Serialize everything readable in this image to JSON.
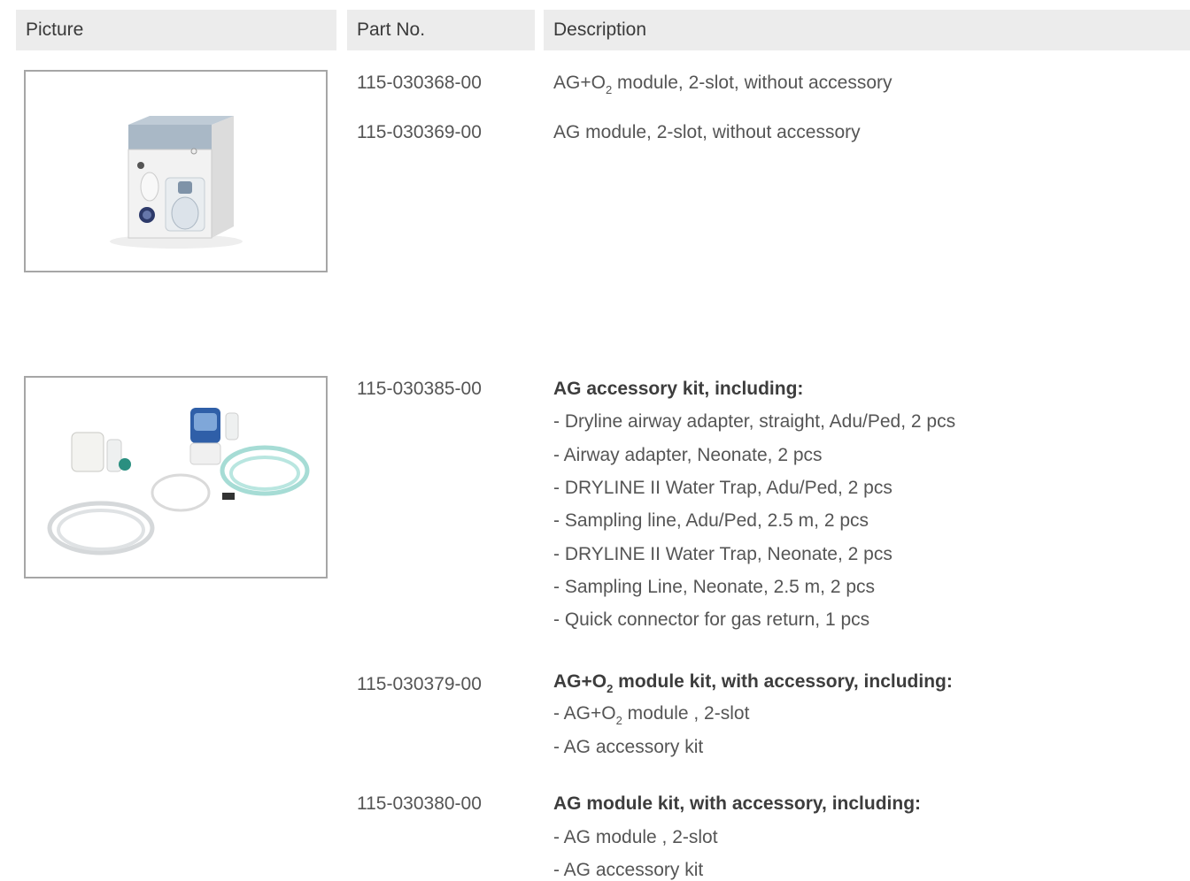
{
  "header": {
    "col_picture": "Picture",
    "col_part": "Part No.",
    "col_desc": "Description"
  },
  "rows": [
    {
      "part": "115-030368-00",
      "desc_pre": "AG+O",
      "desc_sub": "2",
      "desc_post": " module, 2-slot, without accessory"
    },
    {
      "part": "115-030369-00",
      "desc": "AG module, 2-slot, without accessory"
    }
  ],
  "kit": {
    "part": "115-030385-00",
    "title": "AG accessory kit, including:",
    "items": [
      "- Dryline airway adapter, straight, Adu/Ped, 2 pcs",
      "- Airway adapter, Neonate, 2 pcs",
      "- DRYLINE II Water Trap, Adu/Ped, 2 pcs",
      "- Sampling line, Adu/Ped, 2.5 m, 2 pcs",
      "- DRYLINE II Water Trap, Neonate, 2 pcs",
      "- Sampling Line, Neonate, 2.5 m, 2 pcs",
      "- Quick connector for gas return, 1 pcs"
    ]
  },
  "kit2": {
    "part": "115-030379-00",
    "title_pre": "AG+O",
    "title_sub": "2",
    "title_post": " module kit, with accessory, including:",
    "item1_pre": "- AG+O",
    "item1_sub": "2",
    "item1_post": " module , 2-slot",
    "item2": "- AG accessory kit"
  },
  "kit3": {
    "part": "115-030380-00",
    "title": "AG module kit, with accessory, including:",
    "item1": "- AG module , 2-slot",
    "item2": "- AG accessory kit"
  }
}
